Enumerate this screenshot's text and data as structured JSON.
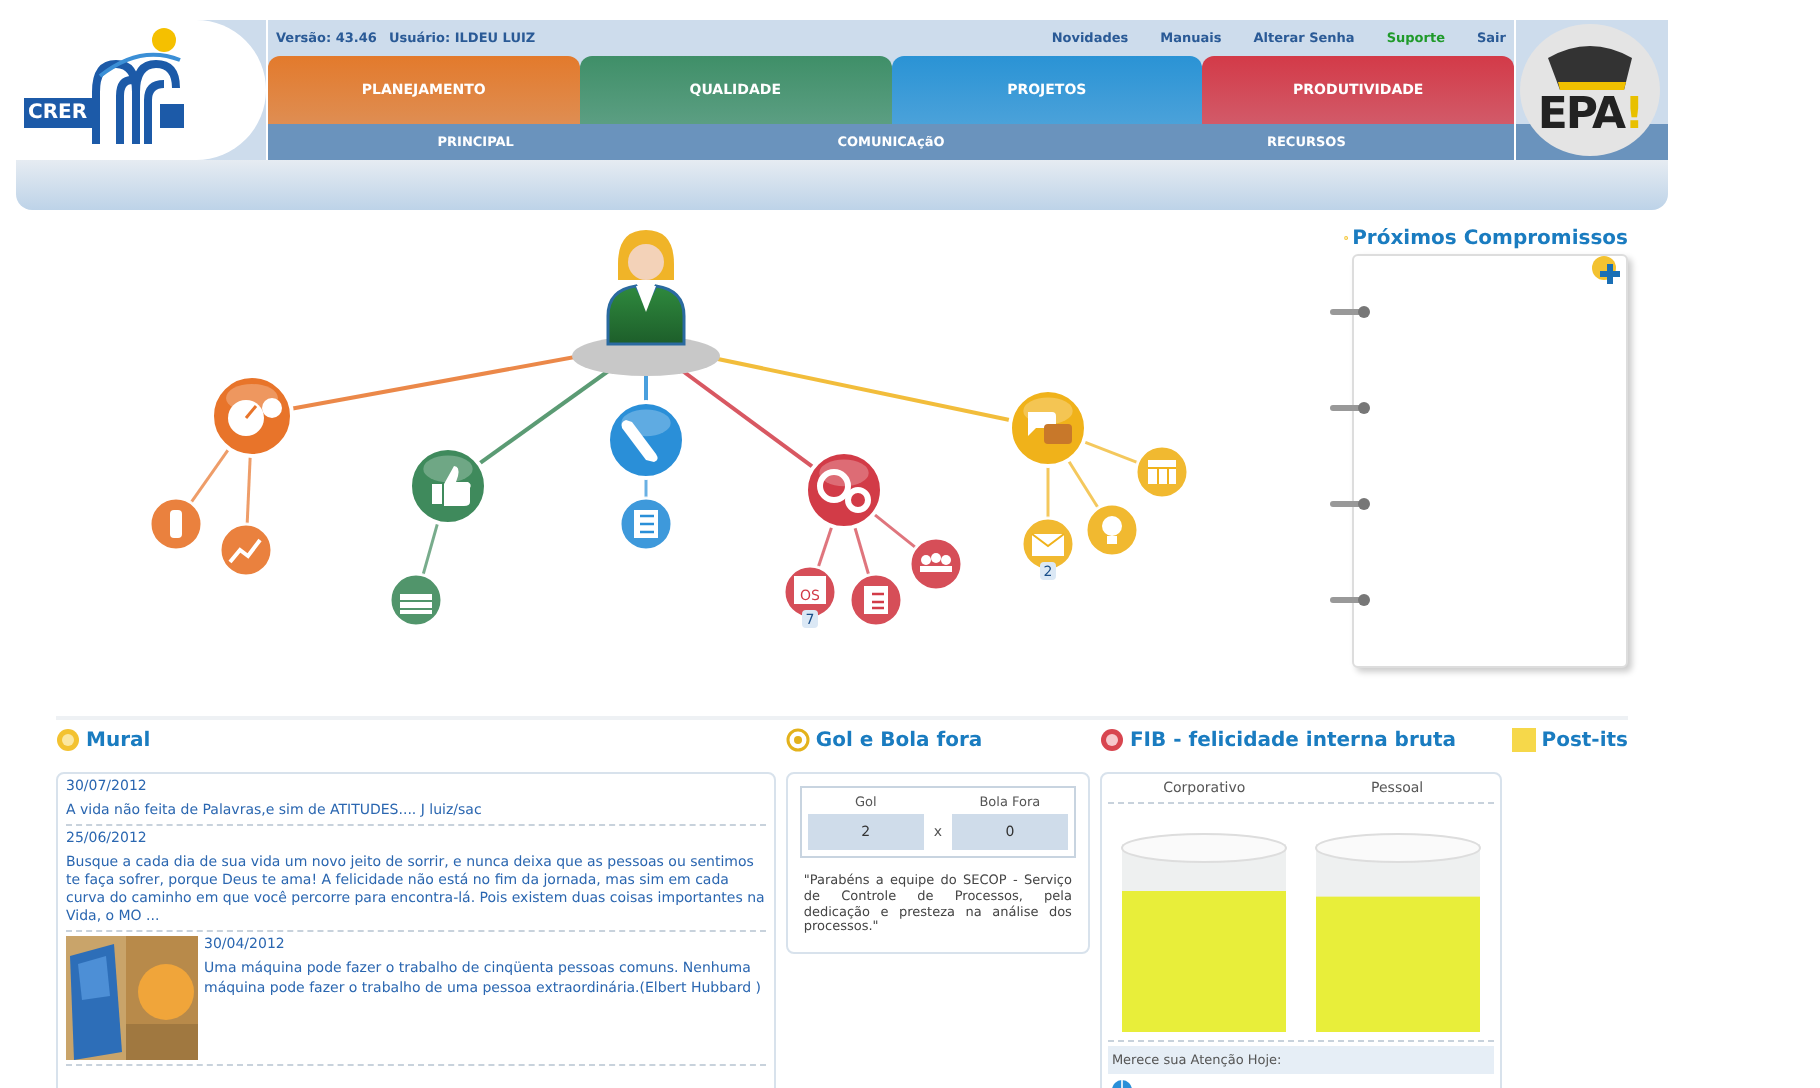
{
  "header": {
    "logo": "CRER",
    "version": "Versão: 43.46",
    "user": "Usuário: ILDEU LUIZ",
    "links": [
      {
        "label": "Novidades",
        "kind": "normal"
      },
      {
        "label": "Manuais",
        "kind": "normal"
      },
      {
        "label": "Alterar Senha",
        "kind": "normal"
      },
      {
        "label": "Suporte",
        "kind": "highlight"
      },
      {
        "label": "Sair",
        "kind": "normal"
      }
    ],
    "tabs": [
      {
        "label": "PLANEJAMENTO",
        "color": "#e37a2c"
      },
      {
        "label": "QUALIDADE",
        "color": "#3f8f68"
      },
      {
        "label": "PROJETOS",
        "color": "#2a93d5"
      },
      {
        "label": "PRODUTIVIDADE",
        "color": "#d33a48"
      }
    ],
    "subnav": [
      "PRINCIPAL",
      "COMUNICAçãO",
      "RECURSOS"
    ],
    "epa_logo": {
      "text": "EPA",
      "mark": "!"
    }
  },
  "map": {
    "branches": [
      {
        "color": "#e8742a",
        "kind": "gauge",
        "children": [
          {
            "kind": "traffic-light"
          },
          {
            "kind": "trend"
          }
        ]
      },
      {
        "color": "#3f8a5c",
        "kind": "thumbs-up",
        "children": [
          {
            "kind": "stack"
          }
        ]
      },
      {
        "color": "#2a8fd8",
        "kind": "scroll",
        "children": [
          {
            "kind": "list"
          }
        ]
      },
      {
        "color": "#d23b47",
        "kind": "gears",
        "children": [
          {
            "kind": "form",
            "label": "OS",
            "badge": "7"
          },
          {
            "kind": "checklist"
          },
          {
            "kind": "people"
          }
        ]
      },
      {
        "color": "#f0b21a",
        "kind": "chat",
        "children": [
          {
            "kind": "mail",
            "badge": "2"
          },
          {
            "kind": "bulb"
          },
          {
            "kind": "calendar"
          }
        ]
      }
    ]
  },
  "agenda": {
    "title": "Próximos Compromissos"
  },
  "mural": {
    "title": "Mural",
    "posts": [
      {
        "kind": "text",
        "date": "30/07/2012",
        "text": "A vida não feita de Palavras,e sim de ATITUDES.... J luiz/sac"
      },
      {
        "kind": "text",
        "date": "25/06/2012",
        "text": "Busque a cada dia de sua vida um novo jeito de sorrir, e nunca deixa que as pessoas ou sentimos te faça sofrer, porque Deus te ama! A felicidade não está no fim da jornada, mas sim em cada curva do caminho em que você percorre para encontra-lá. Pois existem duas coisas importantes na Vida, o MO ..."
      },
      {
        "kind": "picture",
        "date": "30/04/2012",
        "text": "Uma máquina pode fazer o trabalho de cinqüenta pessoas comuns. Nenhuma máquina pode fazer o trabalho de uma pessoa extraordinária.(Elbert Hubbard )"
      }
    ]
  },
  "gol": {
    "title": "Gol e Bola fora",
    "columns": [
      "Gol",
      "Bola Fora"
    ],
    "values": [
      "2",
      "0"
    ],
    "separator": "x",
    "message": "\"Parabéns a equipe do SECOP - Serviço de Controle de Processos, pela dedicação e presteza na análise dos processos.\""
  },
  "fib": {
    "title": "FIB - felicidade interna bruta",
    "columns": [
      {
        "label": "Corporativo",
        "level": 0.75
      },
      {
        "label": "Pessoal",
        "level": 0.72
      }
    ],
    "attention": "Merece sua Atenção Hoje:"
  },
  "postits": {
    "title": "Post-its"
  }
}
